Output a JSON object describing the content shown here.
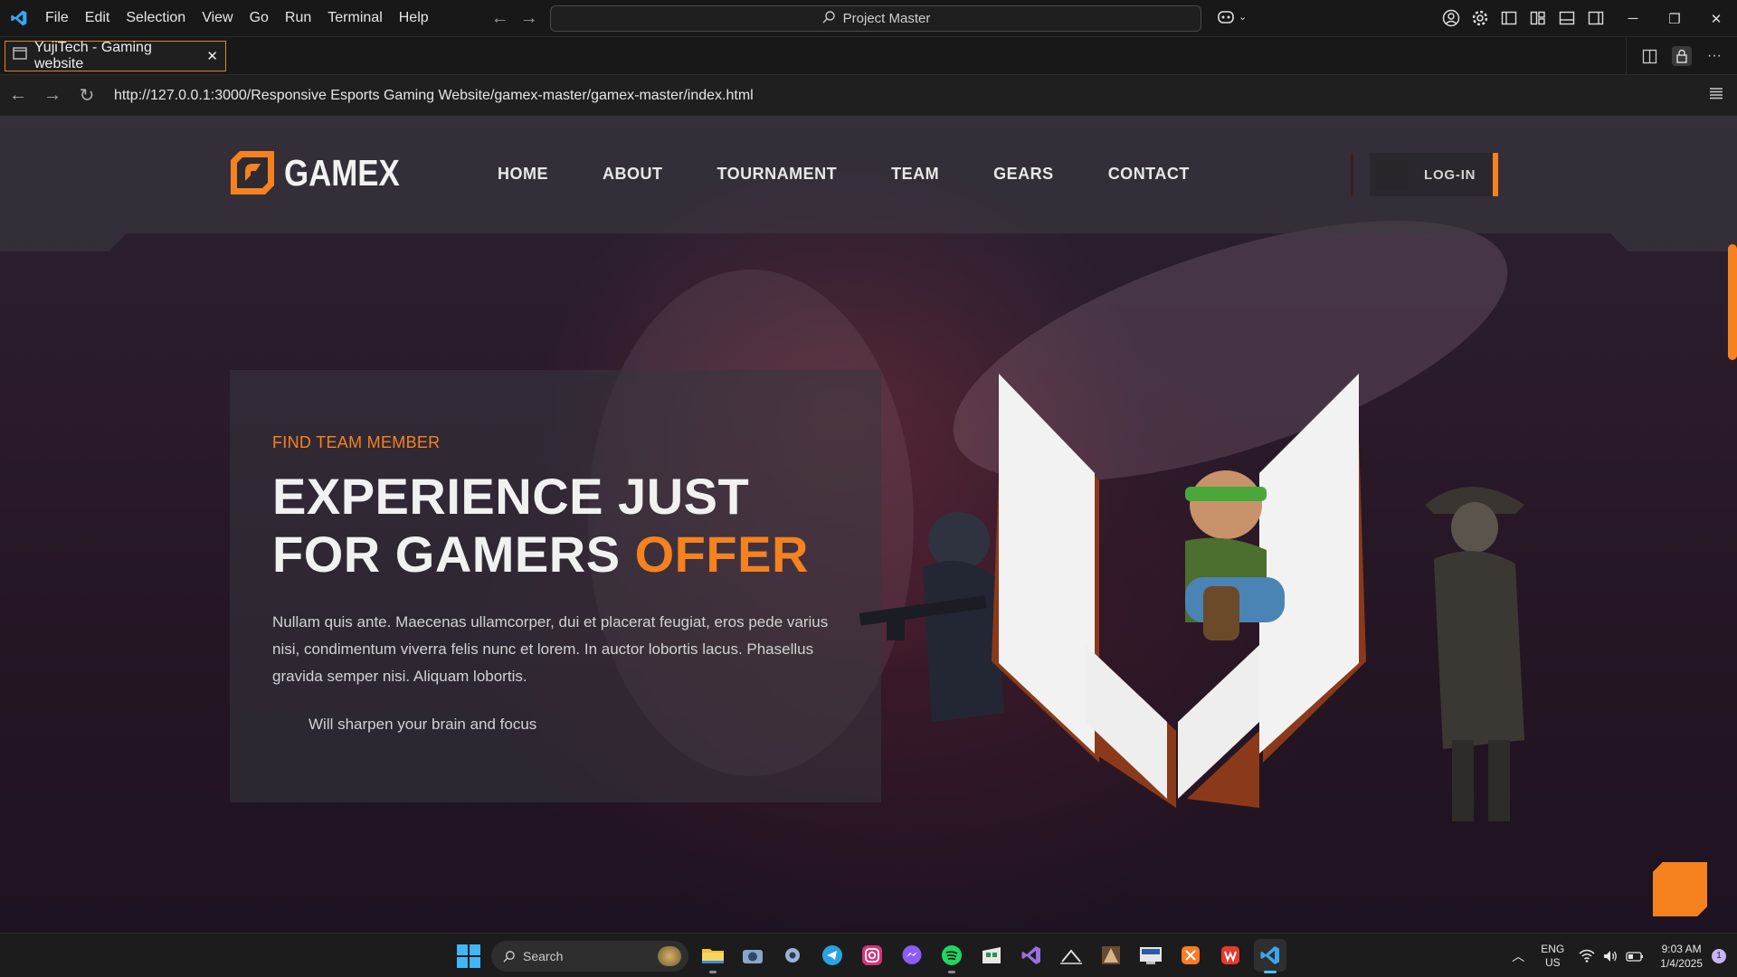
{
  "vscode": {
    "menu": [
      "File",
      "Edit",
      "Selection",
      "View",
      "Go",
      "Run",
      "Terminal",
      "Help"
    ],
    "command_center": "Project Master",
    "tab_title": "YujiTech - Gaming website"
  },
  "browser": {
    "url": "http://127.0.0.1:3000/Responsive Esports Gaming Website/gamex-master/gamex-master/index.html"
  },
  "site": {
    "logo_text": "GAMEX",
    "nav": [
      "HOME",
      "ABOUT",
      "TOURNAMENT",
      "TEAM",
      "GEARS",
      "CONTACT"
    ],
    "login_label": "LOG-IN",
    "accent_color": "#f5821f",
    "hero": {
      "eyebrow": "FIND TEAM MEMBER",
      "headline_line1": "EXPERIENCE JUST",
      "headline_line2": "FOR GAMERS",
      "headline_accent": "OFFER",
      "paragraph": "Nullam quis ante. Maecenas ullamcorper, dui et placerat feugiat, eros pede varius nisi, condimentum viverra felis nunc et lorem. In auctor lobortis lacus. Phasellus gravida semper nisi. Aliquam lobortis.",
      "subtext": "Will sharpen your brain and focus"
    }
  },
  "taskbar": {
    "search_label": "Search",
    "apps": [
      "file-explorer",
      "camera",
      "settings",
      "telegram",
      "instagram",
      "messenger",
      "spotify",
      "store",
      "visual-studio",
      "terminal",
      "game",
      "devtool",
      "xampp",
      "wps",
      "vscode"
    ],
    "lang_line1": "ENG",
    "lang_line2": "US",
    "time": "9:03 AM",
    "date": "1/4/2025",
    "notification_count": "1"
  }
}
